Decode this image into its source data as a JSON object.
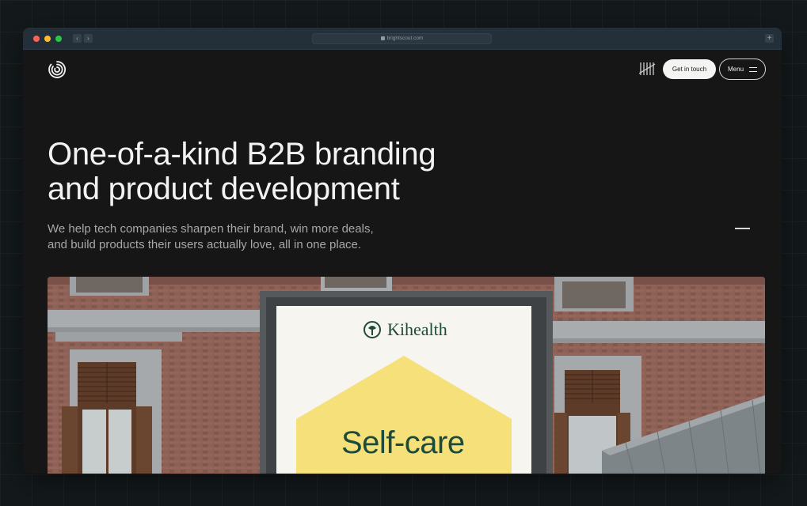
{
  "browser": {
    "url": "brightscout.com",
    "back_icon": "‹",
    "forward_icon": "›",
    "new_tab_icon": "+"
  },
  "header": {
    "logo_icon": "spiral-logo-icon",
    "awards_icon": "awwwards-icon",
    "contact_label": "Get in touch",
    "menu_label": "Menu"
  },
  "hero": {
    "title_lines": [
      "One-of-a-kind B2B branding",
      "and product development"
    ],
    "subtitle_lines": [
      "We help tech companies sharpen their brand, win more deals,",
      "and build products their users actually love, all in one place."
    ]
  },
  "image": {
    "brand": "Kihealth",
    "headline": "Self-care"
  },
  "colors": {
    "background": "#161616",
    "billboard_yellow": "#f6e07a",
    "brand_green": "#1e4a3a"
  }
}
